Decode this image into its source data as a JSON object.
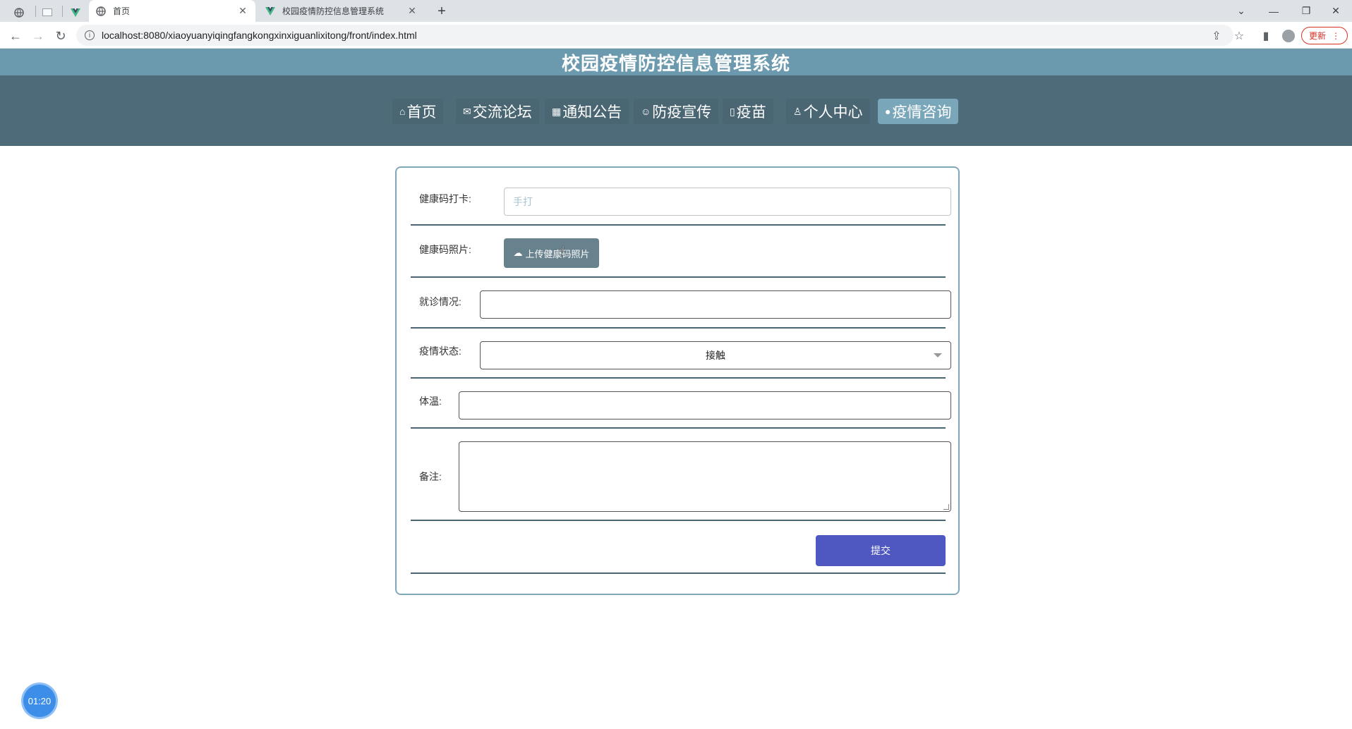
{
  "browser": {
    "tabs": [
      {
        "title": "首页",
        "active": true
      },
      {
        "title": "校园疫情防控信息管理系统",
        "active": false
      }
    ],
    "url": "localhost:8080/xiaoyuanyiqingfangkongxinxiguanlixitong/front/index.html",
    "update_label": "更新"
  },
  "app": {
    "title": "校园疫情防控信息管理系统",
    "nav": [
      {
        "icon": "⌂",
        "label": "首页"
      },
      {
        "icon": "✉",
        "label": "交流论坛"
      },
      {
        "icon": "▦",
        "label": "通知公告"
      },
      {
        "icon": "☺",
        "label": "防疫宣传"
      },
      {
        "icon": "▯",
        "label": "疫苗"
      },
      {
        "icon": "♙",
        "label": "个人中心"
      },
      {
        "icon": "●",
        "label": "疫情咨询"
      }
    ],
    "active_nav": "疫情咨询"
  },
  "form": {
    "health_code_label": "健康码打卡:",
    "health_code_placeholder": "手打",
    "health_photo_label": "健康码照片:",
    "upload_label": "上传健康码照片",
    "treatment_label": "就诊情况:",
    "treatment_value": "",
    "status_label": "疫情状态:",
    "status_value": "接触",
    "temperature_label": "体温:",
    "temperature_value": "",
    "remark_label": "备注:",
    "remark_value": "",
    "submit_label": "提交"
  },
  "timer": "01:20",
  "colors": {
    "header": "#6b9aae",
    "nav_bg": "#4d6b79",
    "active_nav": "#7aa6ba",
    "submit": "#4e58c0",
    "upload": "#67818d"
  }
}
